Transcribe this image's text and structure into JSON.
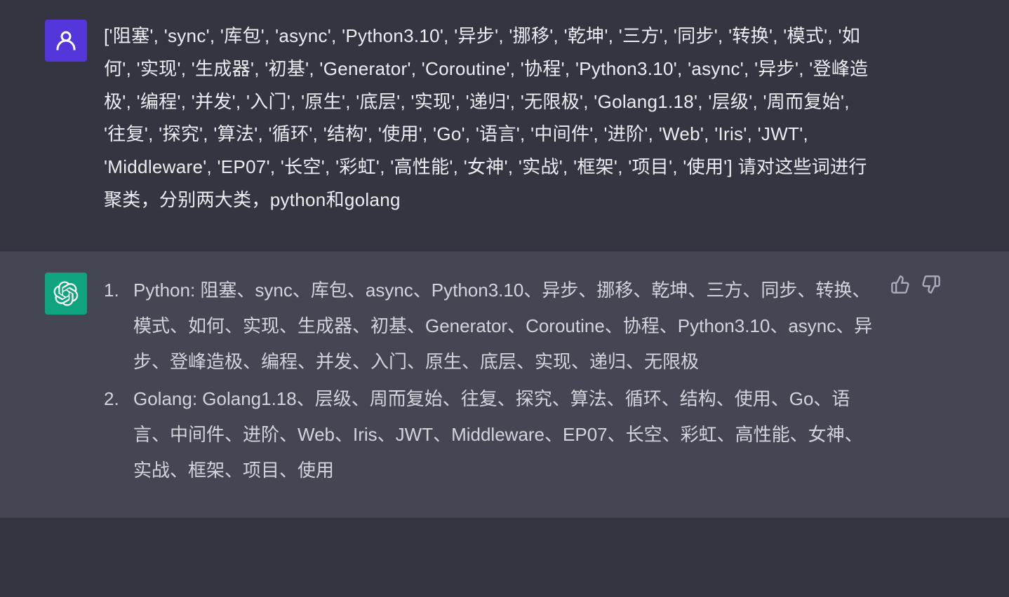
{
  "messages": {
    "user": {
      "content": "['阻塞', 'sync', '库包', 'async', 'Python3.10', '异步', '挪移', '乾坤', '三方', '同步', '转换', '模式', '如何', '实现', '生成器', '初基', 'Generator', 'Coroutine', '协程', 'Python3.10', 'async', '异步', '登峰造极', '编程', '并发', '入门', '原生', '底层', '实现', '递归', '无限极', 'Golang1.18', '层级', '周而复始', '往复', '探究', '算法', '循环', '结构', '使用', 'Go', '语言', '中间件', '进阶', 'Web', 'Iris', 'JWT', 'Middleware', 'EP07', '长空', '彩虹', '高性能', '女神', '实战', '框架', '项目', '使用'] 请对这些词进行聚类，分别两大类，python和golang"
    },
    "assistant": {
      "items": [
        "Python: 阻塞、sync、库包、async、Python3.10、异步、挪移、乾坤、三方、同步、转换、模式、如何、实现、生成器、初基、Generator、Coroutine、协程、Python3.10、async、异步、登峰造极、编程、并发、入门、原生、底层、实现、递归、无限极",
        "Golang: Golang1.18、层级、周而复始、往复、探究、算法、循环、结构、使用、Go、语言、中间件、进阶、Web、Iris、JWT、Middleware、EP07、长空、彩虹、高性能、女神、实战、框架、项目、使用"
      ]
    }
  },
  "icons": {
    "user": "user-icon",
    "assistant": "openai-icon",
    "thumbs_up": "thumbs-up-icon",
    "thumbs_down": "thumbs-down-icon"
  }
}
